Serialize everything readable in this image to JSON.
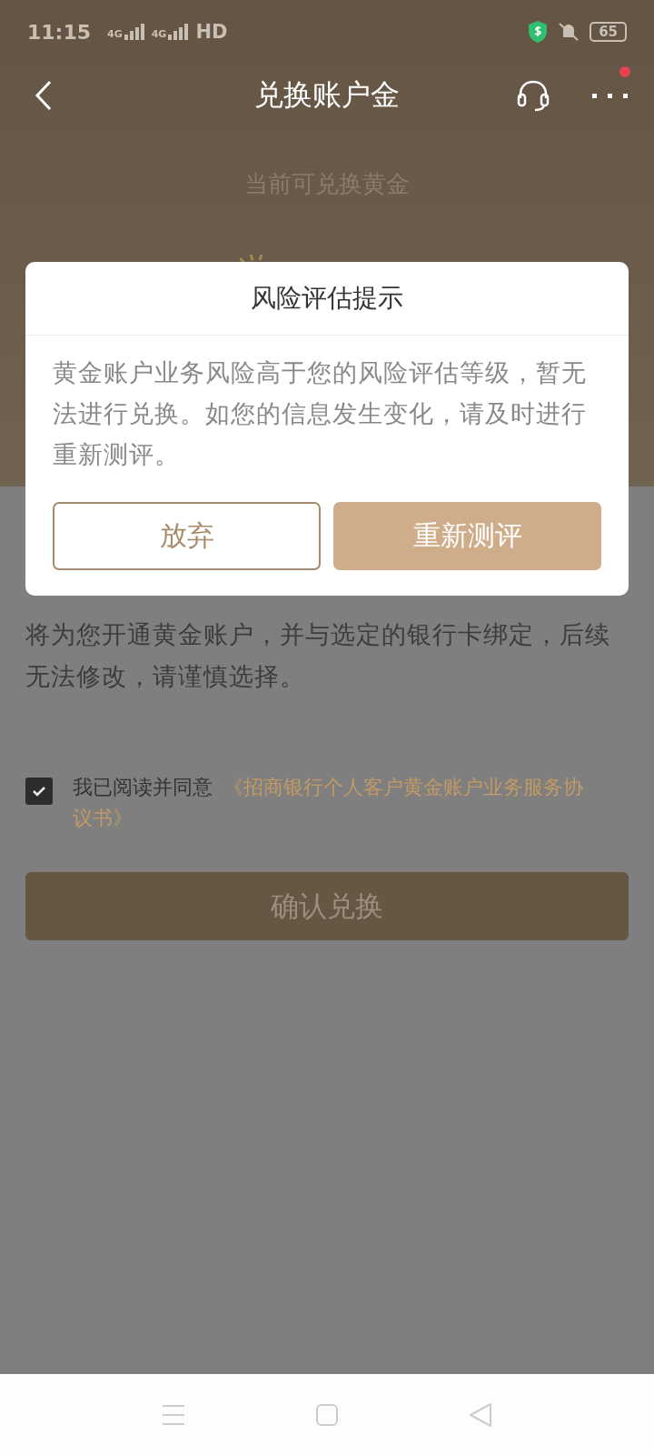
{
  "status_bar": {
    "time": "11:15",
    "networks": [
      "4G",
      "4G"
    ],
    "hd": "HD",
    "battery": "65"
  },
  "nav": {
    "title": "兑换账户金",
    "notification": true
  },
  "hero": {
    "label": "当前可兑换黄金"
  },
  "notice": "将为您开通黄金账户，并与选定的银行卡绑定，后续无法修改，请谨慎选择。",
  "agreement": {
    "checked": true,
    "text": "我已阅读并同意",
    "link_lines": [
      "《招商银行个人客户黄金账户业务服务协",
      "议书》"
    ]
  },
  "confirm_button": "确认兑换",
  "dialog": {
    "title": "风险评估提示",
    "message": "黄金账户业务风险高于您的风险评估等级，暂无法进行兑换。如您的信息发生变化，请及时进行重新测评。",
    "buttons": [
      {
        "label": "放弃",
        "kind": "secondary"
      },
      {
        "label": "重新测评",
        "kind": "primary"
      }
    ]
  }
}
